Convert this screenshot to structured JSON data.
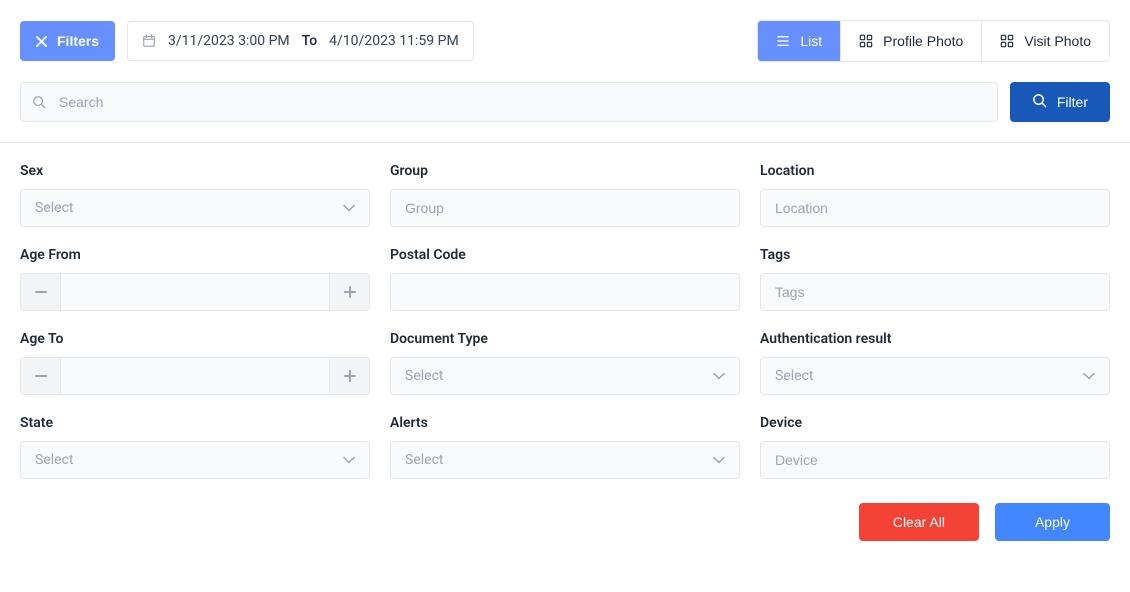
{
  "header": {
    "filters_label": "Filters",
    "date_from": "3/11/2023 3:00 PM",
    "date_to_label": "To",
    "date_to": "4/10/2023 11:59 PM",
    "view_list": "List",
    "view_profile_photo": "Profile Photo",
    "view_visit_photo": "Visit Photo"
  },
  "search": {
    "placeholder": "Search",
    "filter_btn": "Filter"
  },
  "form": {
    "sex": {
      "label": "Sex",
      "placeholder": "Select"
    },
    "group": {
      "label": "Group",
      "placeholder": "Group"
    },
    "location": {
      "label": "Location",
      "placeholder": "Location"
    },
    "age_from": {
      "label": "Age From"
    },
    "postal_code": {
      "label": "Postal Code"
    },
    "tags": {
      "label": "Tags",
      "placeholder": "Tags"
    },
    "age_to": {
      "label": "Age To"
    },
    "document_type": {
      "label": "Document Type",
      "placeholder": "Select"
    },
    "auth_result": {
      "label": "Authentication result",
      "placeholder": "Select"
    },
    "state": {
      "label": "State",
      "placeholder": "Select"
    },
    "alerts": {
      "label": "Alerts",
      "placeholder": "Select"
    },
    "device": {
      "label": "Device",
      "placeholder": "Device"
    }
  },
  "actions": {
    "clear_all": "Clear All",
    "apply": "Apply"
  }
}
